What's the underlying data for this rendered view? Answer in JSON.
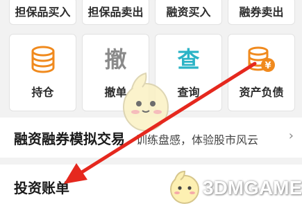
{
  "top_actions": [
    {
      "label": "担保品买入"
    },
    {
      "label": "担保品卖出"
    },
    {
      "label": "融资买入"
    },
    {
      "label": "融券卖出"
    }
  ],
  "quick_actions": [
    {
      "label": "持仓",
      "icon": "coins-stack-icon"
    },
    {
      "label": "撤单",
      "icon": "withdraw-icon",
      "glyph": "撤"
    },
    {
      "label": "查询",
      "icon": "query-icon",
      "glyph": "查"
    },
    {
      "label": "资产负债",
      "icon": "coins-yuan-icon"
    }
  ],
  "menu": {
    "simulation": {
      "title": "融资融券模拟交易",
      "subtitle": "训练盘感，体验股市风云",
      "chevron": "›"
    },
    "account": {
      "title": "投资账单"
    }
  },
  "watermark": {
    "text": "3DMGAME"
  },
  "colors": {
    "orange": "#f08a1e",
    "teal": "#2bb3c6",
    "gray": "#8a8a8a",
    "arrow": "#e5281e"
  }
}
